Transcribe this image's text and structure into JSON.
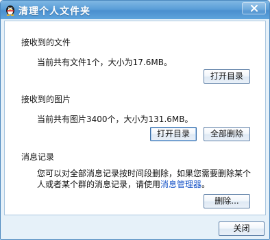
{
  "window": {
    "title": "清理个人文件夹"
  },
  "received_files": {
    "heading": "接收到的文件",
    "summary": "当前共有文件1个，大小为17.6MB。",
    "open_dir_label": "打开目录"
  },
  "received_images": {
    "heading": "接收到的图片",
    "summary": "当前共有图片3400个，大小为131.6MB。",
    "open_dir_label": "打开目录",
    "delete_all_label": "全部删除"
  },
  "message_log": {
    "heading": "消息记录",
    "desc_line1": "您可以对全部消息记录按时间段删除，如果您需要删除某个",
    "desc_line2_prefix": "人或者某个群的消息记录，请使用",
    "desc_link": "消息管理器",
    "desc_suffix": "。",
    "delete_label": "删除..."
  },
  "footer": {
    "close_label": "关闭"
  },
  "icons": {
    "app_icon": "qq-penguin-icon",
    "window_close": "close-icon"
  },
  "colors": {
    "title_bar": "#5b9fd8",
    "frame_bg": "#e6f1f9",
    "link": "#1a56c8"
  }
}
